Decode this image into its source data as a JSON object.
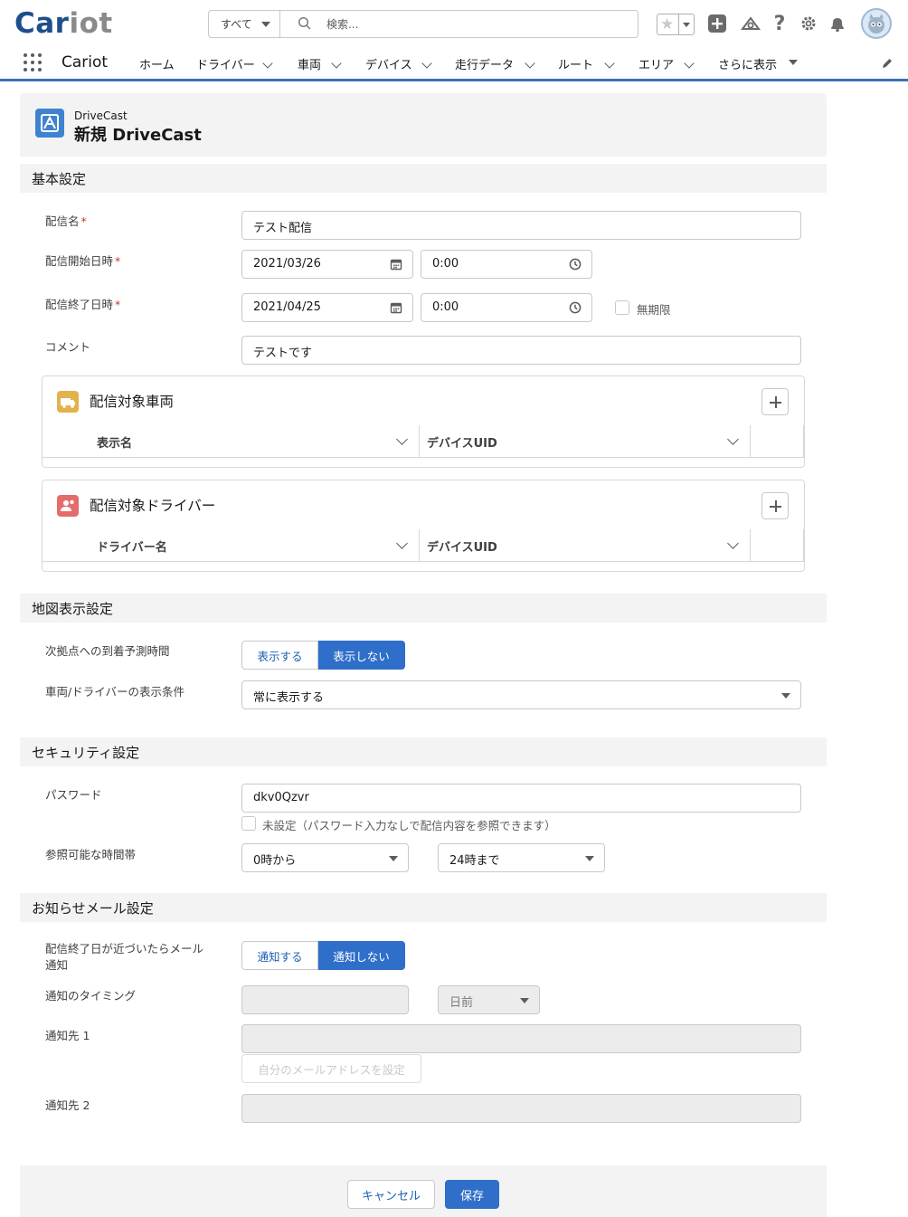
{
  "header": {
    "logo_main": "Car",
    "logo_rest": "iot",
    "search_scope": "すべて",
    "search_placeholder": "検索..."
  },
  "nav": {
    "app_name": "Cariot",
    "items": [
      {
        "label": "ホーム"
      },
      {
        "label": "ドライバー"
      },
      {
        "label": "車両"
      },
      {
        "label": "デバイス"
      },
      {
        "label": "走行データ"
      },
      {
        "label": "ルート"
      },
      {
        "label": "エリア"
      },
      {
        "label": "さらに表示"
      }
    ]
  },
  "record": {
    "object_label": "DriveCast",
    "title": "新規 DriveCast"
  },
  "sections": {
    "basic": "基本設定",
    "map": "地図表示設定",
    "security": "セキュリティ設定",
    "mail": "お知らせメール設定"
  },
  "basic": {
    "name_label": "配信名",
    "name_value": "テスト配信",
    "start_label": "配信開始日時",
    "start_date": "2021/03/26",
    "start_time": "0:00",
    "end_label": "配信終了日時",
    "end_date": "2021/04/25",
    "end_time": "0:00",
    "unlimited_label": "無期限",
    "comment_label": "コメント",
    "comment_value": "テストです",
    "required_mark": "*"
  },
  "related_vehicles": {
    "title": "配信対象車両",
    "col1": "表示名",
    "col2": "デバイスUID"
  },
  "related_drivers": {
    "title": "配信対象ドライバー",
    "col1": "ドライバー名",
    "col2": "デバイスUID"
  },
  "map": {
    "eta_label": "次拠点への到着予測時間",
    "eta_show": "表示する",
    "eta_hide": "表示しない",
    "cond_label": "車両/ドライバーの表示条件",
    "cond_value": "常に表示する"
  },
  "security": {
    "password_label": "パスワード",
    "password_value": "dkv0Qzvr",
    "unset_label": "未設定（パスワード入力なしで配信内容を参照できます）",
    "hours_label": "参照可能な時間帯",
    "from_value": "0時から",
    "to_value": "24時まで"
  },
  "mail": {
    "notify_label_1": "配信終了日が近づいたらメール",
    "notify_label_2": "通知",
    "notify_on": "通知する",
    "notify_off": "通知しない",
    "timing_label": "通知のタイミング",
    "timing_unit": "日前",
    "to1_label": "通知先 1",
    "self_button": "自分のメールアドレスを設定",
    "to2_label": "通知先 2"
  },
  "footer": {
    "cancel": "キャンセル",
    "save": "保存"
  },
  "colors": {
    "brand": "#2f6fc9",
    "vehicle_icon": "#e4b24a",
    "driver_icon": "#e46c6c",
    "object_icon": "#3f82d0"
  }
}
